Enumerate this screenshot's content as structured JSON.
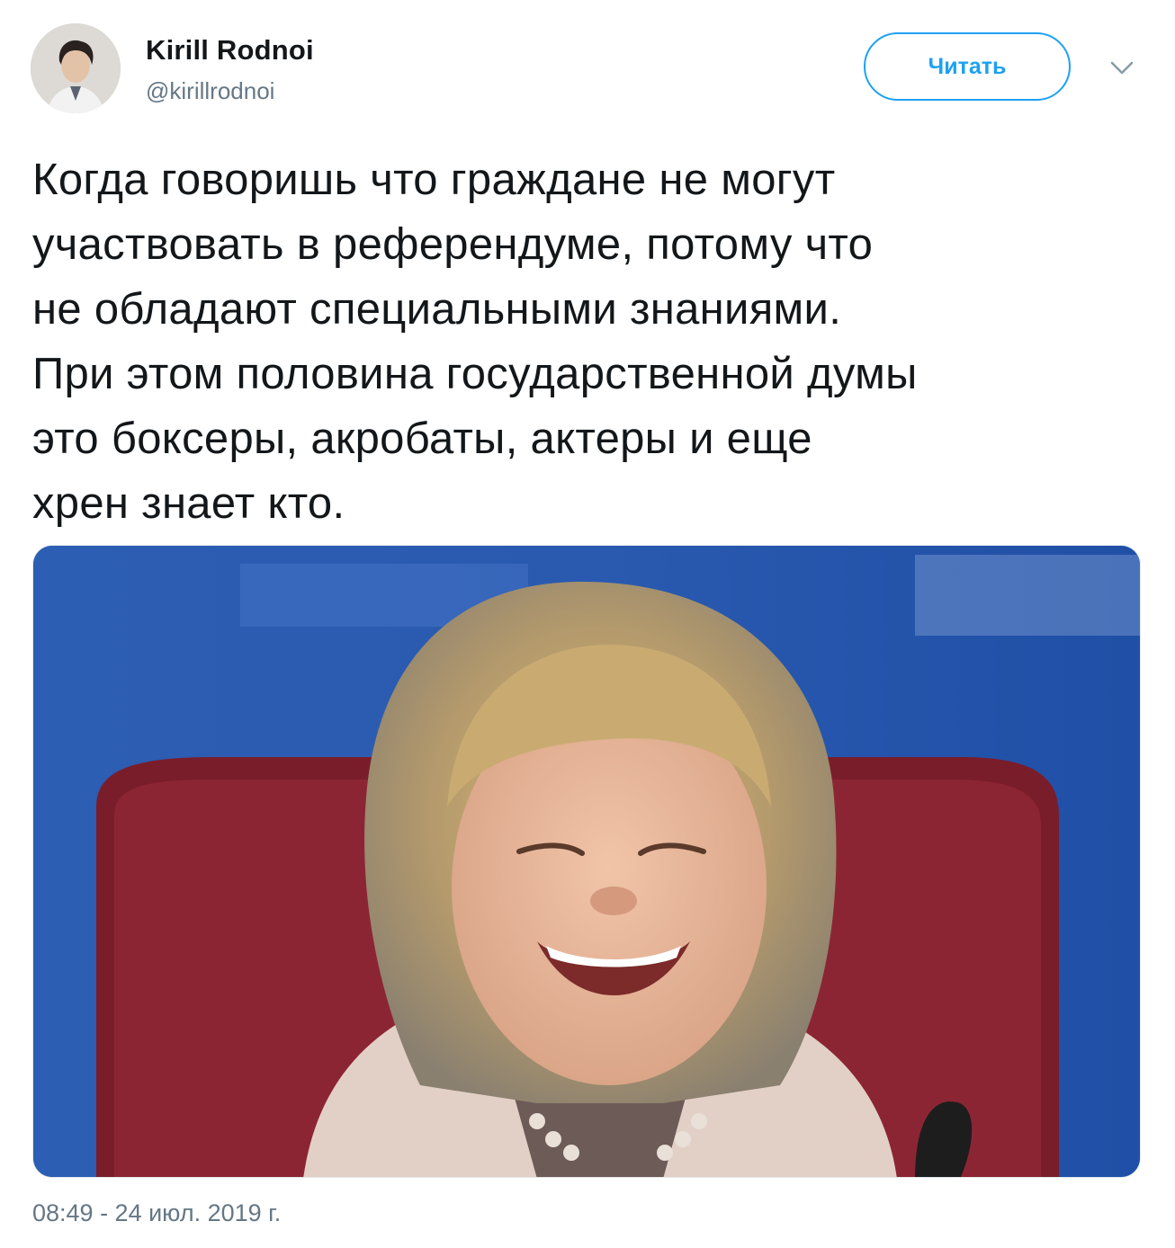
{
  "user": {
    "display_name": "Kirill Rodnoi",
    "handle": "@kirillrodnoi",
    "avatar_icon": "user-avatar-photo"
  },
  "actions": {
    "follow_label": "Читать",
    "more_icon": "chevron-down-icon"
  },
  "tweet": {
    "text": "Когда говоришь что граждане не могут\nучаствовать в референдуме, потому что\nне обладают специальными знаниями.\nПри этом половина государственной думы\nэто боксеры, акробаты, актеры и еще\nхрен знает кто.",
    "media_icon": "photo-laughing-woman",
    "timestamp": "08:49 - 24 июл. 2019 г."
  },
  "colors": {
    "accent": "#1da1f2",
    "text_primary": "#14171a",
    "text_secondary": "#657786"
  }
}
